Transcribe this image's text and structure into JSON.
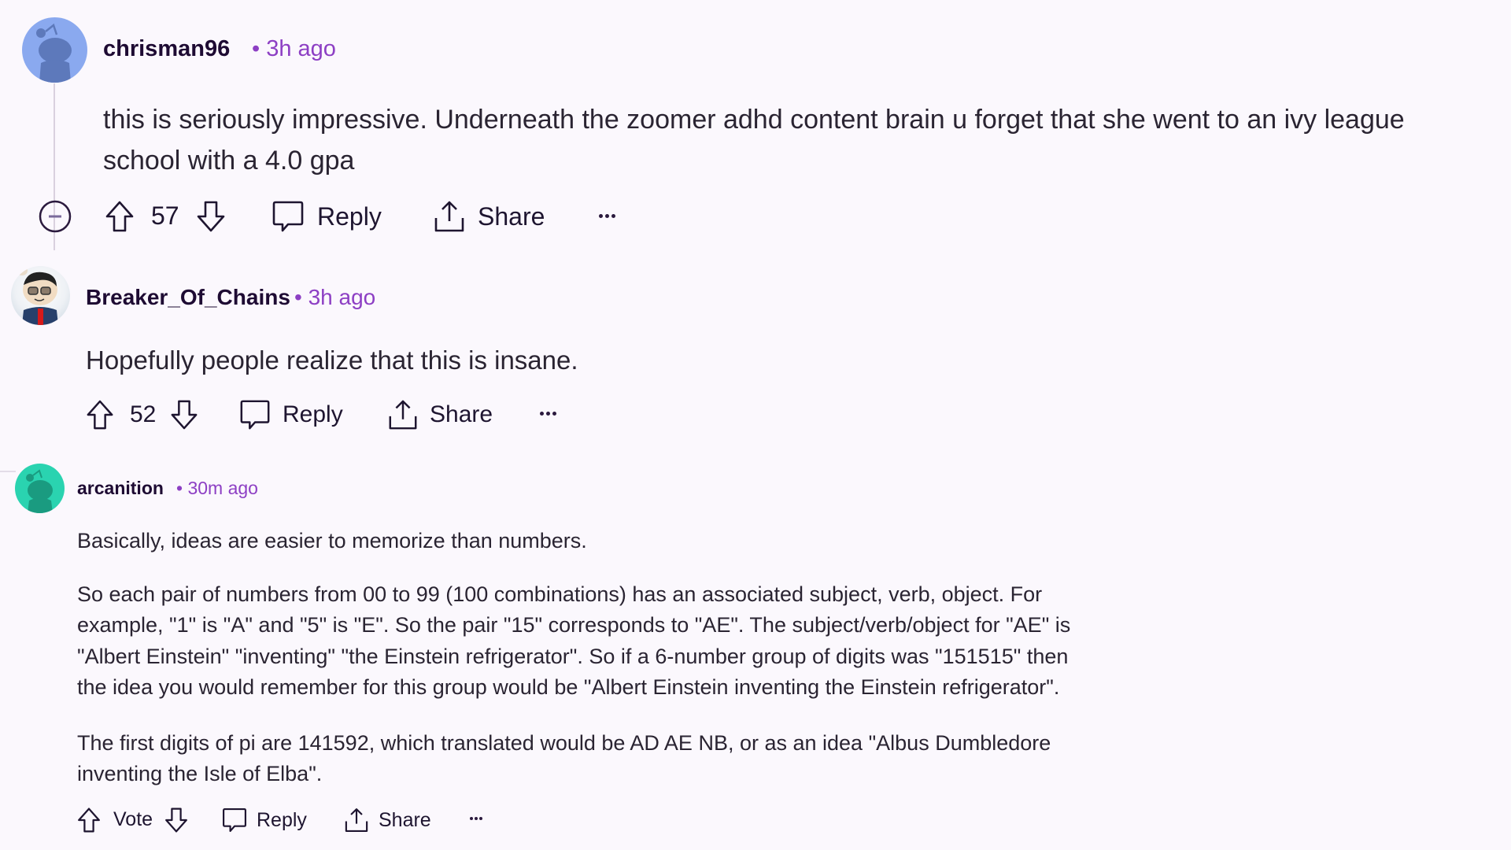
{
  "colors": {
    "background": "#fbf8fd",
    "username": "#1e0b33",
    "timestamp": "#8d3fc4",
    "body_text": "#2a2432",
    "icon": "#1e1530",
    "avatar_blue": "#8aa9ef",
    "avatar_teal": "#2ad3b0"
  },
  "comments": [
    {
      "username": "chrisman96",
      "separator": "•",
      "time": "3h ago",
      "avatar_icon": "snoo-avatar-blue",
      "body": [
        "this is seriously impressive. Underneath the zoomer adhd content brain u forget that she went to an ivy league",
        "school with a 4.0 gpa"
      ],
      "score": "57",
      "actions": {
        "reply": "Reply",
        "share": "Share"
      },
      "collapse_icon": "collapse-minus-icon"
    },
    {
      "username": "Breaker_Of_Chains",
      "separator": "•",
      "time": "3h ago",
      "avatar_icon": "custom-character-avatar",
      "body": [
        "Hopefully people realize that this is insane."
      ],
      "score": "52",
      "actions": {
        "reply": "Reply",
        "share": "Share"
      }
    },
    {
      "username": "arcanition",
      "separator": "•",
      "time": "30m ago",
      "avatar_icon": "snoo-avatar-teal",
      "paragraphs": [
        [
          "Basically, ideas are easier to memorize than numbers."
        ],
        [
          "So each pair of numbers from 00 to 99 (100 combinations) has an associated subject, verb, object. For",
          "example, \"1\" is \"A\" and \"5\" is \"E\". So the pair \"15\" corresponds to \"AE\". The subject/verb/object for \"AE\" is",
          "\"Albert Einstein\" \"inventing\" \"the Einstein refrigerator\". So if a 6-number group of digits was \"151515\" then",
          "the idea you would remember for this group would be \"Albert Einstein inventing the Einstein refrigerator\"."
        ],
        [
          "The first digits of pi are 141592, which translated would be AD AE NB, or as an idea \"Albus Dumbledore",
          "inventing the Isle of Elba\"."
        ]
      ],
      "score": "Vote",
      "actions": {
        "reply": "Reply",
        "share": "Share"
      }
    }
  ]
}
